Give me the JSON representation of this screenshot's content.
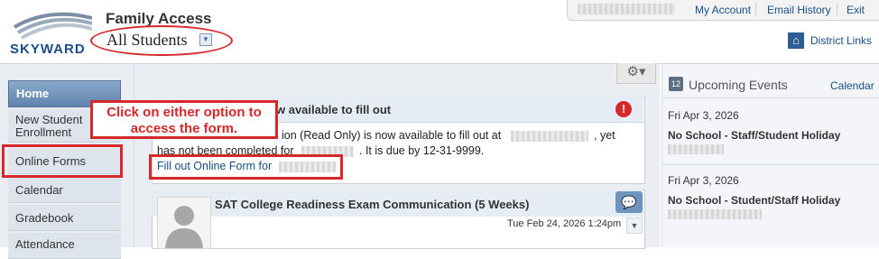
{
  "header": {
    "app_title": "Family Access",
    "student_selector": "All Students",
    "logo_text": "SKYWARD",
    "links": {
      "my_account": "My Account",
      "email_history": "Email History",
      "exit": "Exit"
    },
    "district_links": "District Links"
  },
  "sidebar": {
    "items": [
      {
        "label": "Home",
        "active": true
      },
      {
        "label": "New Student Enrollment"
      },
      {
        "label": "Online Forms"
      },
      {
        "label": "Calendar"
      },
      {
        "label": "Gradebook"
      },
      {
        "label": "Attendance"
      }
    ]
  },
  "main": {
    "card1": {
      "title": "w available to fill out",
      "line1": "ion (Read Only) is now available to fill out at",
      "line1_end": ", yet",
      "line2_start": "has not been completed for",
      "line2_end": ".  It is due by 12-31-9999.",
      "fill_link": "Fill out Online Form for"
    },
    "callout": "Click on either option to access the form.",
    "card2": {
      "title": "SAT College Readiness Exam Communication (5 Weeks)",
      "date": "Tue Feb 24, 2026 1:24pm"
    }
  },
  "events": {
    "title": "Upcoming Events",
    "calendar_link": "Calendar",
    "calendar_icon_day": "12",
    "items": [
      {
        "date": "Fri Apr 3, 2026",
        "name": "No School - Staff/Student Holiday"
      },
      {
        "date": "Fri Apr 3, 2026",
        "name": "No School - Student/Staff Holiday"
      }
    ]
  },
  "colors": {
    "accent_red": "#d6282a",
    "link_blue": "#1a4e86",
    "nav_active": "#6f8fb4"
  }
}
